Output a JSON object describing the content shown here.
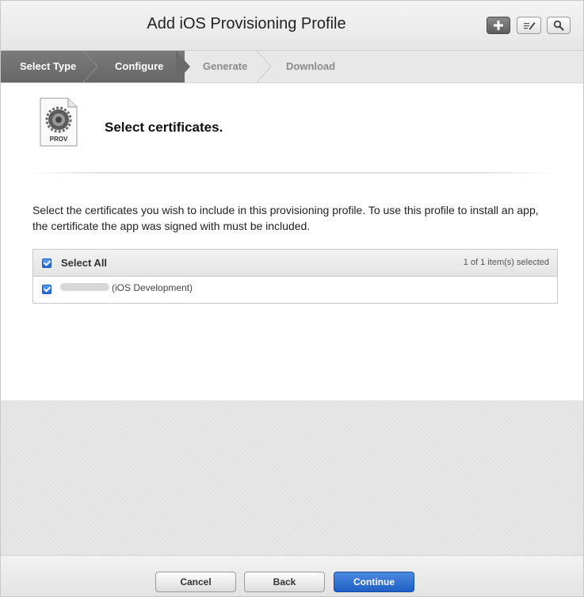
{
  "header": {
    "title": "Add iOS Provisioning Profile",
    "buttons": [
      {
        "icon": "plus-icon"
      },
      {
        "icon": "edit-icon"
      },
      {
        "icon": "search-icon"
      }
    ]
  },
  "steps": [
    {
      "label": "Select Type",
      "state": "done"
    },
    {
      "label": "Configure",
      "state": "current"
    },
    {
      "label": "Generate",
      "state": "todo"
    },
    {
      "label": "Download",
      "state": "todo"
    }
  ],
  "main": {
    "icon_label": "PROV",
    "heading": "Select certificates.",
    "description": "Select the certificates you wish to include in this provisioning profile. To use this profile to install an app, the certificate the app was signed with must be included.",
    "table": {
      "select_all_label": "Select All",
      "selected_count": "1 of 1 item(s) selected",
      "rows": [
        {
          "name_suffix": "(iOS Development)",
          "checked": true
        }
      ]
    }
  },
  "footer": {
    "cancel_label": "Cancel",
    "back_label": "Back",
    "continue_label": "Continue"
  },
  "colors": {
    "primary_button": "#1e5fc4",
    "step_active_bg": "#6e6e6e",
    "step_todo_text": "#8a8a8a"
  }
}
